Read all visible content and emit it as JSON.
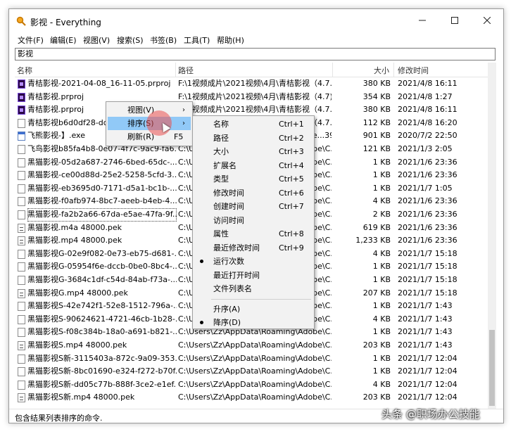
{
  "window": {
    "title": "影视 - Everything",
    "minimize_icon": "minimize-icon",
    "maximize_icon": "maximize-icon",
    "close_icon": "close-icon"
  },
  "menubar": [
    "文件(F)",
    "编辑(E)",
    "视图(V)",
    "搜索(S)",
    "书签(B)",
    "工具(T)",
    "帮助(H)"
  ],
  "search": {
    "value": "影视"
  },
  "columns": {
    "name": "名称",
    "path": "路径",
    "size": "大小",
    "date": "修改时间"
  },
  "rows": [
    {
      "icon": "premiere-icon",
      "name": "青桔影视-2021-04-08_16-11-05.prproj",
      "path": "F:\\1视频成片\\2021视频\\4月\\青桔影视（4.7...",
      "size": "380 KB",
      "date": "2021/4/8 16:11"
    },
    {
      "icon": "premiere-icon",
      "name": "青桔影视.prproj",
      "path": "F:\\1视频成片\\2021视频\\4月\\青桔影视（4.7)",
      "size": "354 KB",
      "date": "2021/4/8 1:27"
    },
    {
      "icon": "premiere-icon",
      "name": "青桔影视.prproj",
      "path": "F:\\1视频成片\\2021视频\\4月\\青桔影视（4.7...",
      "size": "380 KB",
      "date": "2021/4/8 16:11"
    },
    {
      "icon": "file-icon",
      "name": "青桔影视b6d0df28-dd",
      "path": "F:\\1视频成片\\2021视频\\4月\\青桔影视（4.7...",
      "size": "112 KB",
      "date": "2021/4/8 16:20"
    },
    {
      "icon": "exe-icon",
      "name": "飞熊影视-】.exe",
      "path": "C:\\Users\\Zz\\Desktop\\飞熊影视-】.exe...39...",
      "size": "901 KB",
      "date": "2020/7/2 22:50"
    },
    {
      "icon": "file-icon",
      "name": "飞鸟影视b85fa4b8-0e07-4f7c-9ac9-fa6...",
      "path": "C:\\Users\\Zz\\AppData\\Roaming\\Adobe\\C...",
      "size": "121 KB",
      "date": "2021/1/3 2:05"
    },
    {
      "icon": "file-icon",
      "name": "黑猫影视-05d2a687-2746-6bed-65dc-...",
      "path": "C:\\Users\\Zz\\AppData\\Roaming\\Adobe\\C...",
      "size": "1 KB",
      "date": "2021/1/6 23:36"
    },
    {
      "icon": "file-icon",
      "name": "黑猫影视-ce00d88d-25e2-5258-5cfd-3...",
      "path": "C:\\Users\\Zz\\AppData\\Roaming\\Adobe\\C...",
      "size": "1 KB",
      "date": "2021/1/6 23:36"
    },
    {
      "icon": "file-icon",
      "name": "黑猫影视-eb3695d0-7171-d5a1-bc1b-...",
      "path": "C:\\Users\\Zz\\AppData\\Roaming\\Adobe\\C...",
      "size": "1 KB",
      "date": "2021/1/7 1:05"
    },
    {
      "icon": "file-icon",
      "name": "黑猫影视-f0afb974-8bc7-aeeb-b4eb-4...",
      "path": "C:\\Users\\Zz\\AppData\\Roaming\\Adobe\\C...",
      "size": "4 KB",
      "date": "2021/1/6 23:36"
    },
    {
      "icon": "file-icon",
      "name": "黑猫影视-fa2b2a66-67da-e5ae-47fa-9f...",
      "path": "C:\\Users\\Zz\\AppData\\Roaming\\Adobe\\C...",
      "size": "2 KB",
      "date": "2021/1/6 23:36",
      "focus": true
    },
    {
      "icon": "media-icon",
      "name": "黑猫影视.m4a 48000.pek",
      "path": "C:\\Users\\Zz\\AppData\\Roaming\\Adobe\\C...",
      "size": "619 KB",
      "date": "2021/1/6 23:36"
    },
    {
      "icon": "media-icon",
      "name": "黑猫影视.mp4 48000.pek",
      "path": "C:\\Users\\Zz\\AppData\\Roaming\\Adobe\\C...",
      "size": "1,233 KB",
      "date": "2021/1/6 23:36"
    },
    {
      "icon": "file-icon",
      "name": "黑猫影视G-02e9f082-0e73-eb75-d681-...",
      "path": "C:\\Users\\Zz\\AppData\\Roaming\\Adobe\\C...",
      "size": "4 KB",
      "date": "2021/1/7 15:18"
    },
    {
      "icon": "file-icon",
      "name": "黑猫影视G-05954f6e-dccb-0be0-8bc4-...",
      "path": "C:\\Users\\Zz\\AppData\\Roaming\\Adobe\\C...",
      "size": "1 KB",
      "date": "2021/1/7 15:18"
    },
    {
      "icon": "file-icon",
      "name": "黑猫影视G-3684c1df-c54d-84ab-f73a-...",
      "path": "C:\\Users\\Zz\\AppData\\Roaming\\Adobe\\C...",
      "size": "1 KB",
      "date": "2021/1/7 15:18"
    },
    {
      "icon": "media-icon",
      "name": "黑猫影视G.mp4 48000.pek",
      "path": "C:\\Users\\Zz\\AppData\\Roaming\\Adobe\\C...",
      "size": "207 KB",
      "date": "2021/1/7 15:18"
    },
    {
      "icon": "file-icon",
      "name": "黑猫影视S-42e742f1-52e8-1512-796a-...",
      "path": "C:\\Users\\Zz\\AppData\\Roaming\\Adobe\\C...",
      "size": "1 KB",
      "date": "2021/1/7 1:43"
    },
    {
      "icon": "file-icon",
      "name": "黑猫影视S-90624621-4721-46cb-1b28-...",
      "path": "C:\\Users\\Zz\\AppData\\Roaming\\Adobe\\C...",
      "size": "4 KB",
      "date": "2021/1/7 1:43"
    },
    {
      "icon": "file-icon",
      "name": "黑猫影视S-f08c384b-18a0-a691-b821-...",
      "path": "C:\\Users\\Zz\\AppData\\Roaming\\Adobe\\C...",
      "size": "1 KB",
      "date": "2021/1/7 1:43"
    },
    {
      "icon": "media-icon",
      "name": "黑猫影视S.mp4 48000.pek",
      "path": "C:\\Users\\Zz\\AppData\\Roaming\\Adobe\\C...",
      "size": "203 KB",
      "date": "2021/1/7 1:43"
    },
    {
      "icon": "file-icon",
      "name": "黑猫影视S新-3115403a-872c-9a09-353...",
      "path": "C:\\Users\\Zz\\AppData\\Roaming\\Adobe\\C...",
      "size": "1 KB",
      "date": "2021/1/7 12:04"
    },
    {
      "icon": "file-icon",
      "name": "黑猫影视S新-8bc01690-e324-f272-b70f...",
      "path": "C:\\Users\\Zz\\AppData\\Roaming\\Adobe\\C...",
      "size": "1 KB",
      "date": "2021/1/7 12:04"
    },
    {
      "icon": "file-icon",
      "name": "黑猫影视S新-dd05c77b-888f-3ce2-e1ef...",
      "path": "C:\\Users\\Zz\\AppData\\Roaming\\Adobe\\C...",
      "size": "4 KB",
      "date": "2021/1/7 12:04"
    },
    {
      "icon": "media-icon",
      "name": "黑猫影视S新.mp4 48000.pek",
      "path": "C:\\Users\\Zz\\AppData\\Roaming\\Adobe\\C...",
      "size": "203 KB",
      "date": "2021/1/7 12:04"
    }
  ],
  "context_menu": [
    {
      "label": "视图(V)",
      "submenu": true
    },
    {
      "label": "排序(S)",
      "submenu": true,
      "highlighted": true
    },
    {
      "label": "刷新(R)",
      "shortcut": "F5"
    }
  ],
  "sort_submenu": [
    {
      "label": "名称",
      "shortcut": "Ctrl+1"
    },
    {
      "label": "路径",
      "shortcut": "Ctrl+2"
    },
    {
      "label": "大小",
      "shortcut": "Ctrl+3"
    },
    {
      "label": "扩展名",
      "shortcut": "Ctrl+4"
    },
    {
      "label": "类型",
      "shortcut": "Ctrl+5"
    },
    {
      "label": "修改时间",
      "shortcut": "Ctrl+6"
    },
    {
      "label": "创建时间",
      "shortcut": "Ctrl+7"
    },
    {
      "label": "访问时间",
      "shortcut": ""
    },
    {
      "label": "属性",
      "shortcut": "Ctrl+8"
    },
    {
      "label": "最近修改时间",
      "shortcut": "Ctrl+9"
    },
    {
      "label": "运行次数",
      "shortcut": "",
      "checked": true
    },
    {
      "label": "最近打开时间",
      "shortcut": ""
    },
    {
      "label": "文件列表名",
      "shortcut": ""
    },
    {
      "label": "升序(A)",
      "shortcut": ""
    },
    {
      "label": "降序(D)",
      "shortcut": "",
      "checked": true
    }
  ],
  "status": "包含结果列表排序的命令.",
  "watermark": "头条 @职场办公技能"
}
